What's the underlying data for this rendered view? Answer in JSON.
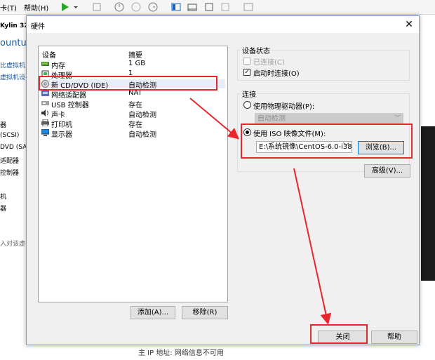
{
  "host": {
    "menu": [
      "卡(T)",
      "帮助(H)"
    ],
    "left_texts": [
      "Kylin 32",
      "ountu",
      "比虚拟机",
      "虚拟机设",
      "器",
      "(SCSI)",
      "DVD (SAT",
      "适配器",
      "控制器",
      "机",
      "器",
      "入对该虚"
    ],
    "bottom_text": "主 IP 地址: 网络信息不可用"
  },
  "dialog": {
    "title": "硬件",
    "close_glyph": "✕",
    "device_table": {
      "headers": [
        "设备",
        "摘要"
      ],
      "rows": [
        {
          "name": "内存",
          "summary": "1 GB",
          "icon": "memory-icon"
        },
        {
          "name": "处理器",
          "summary": "1",
          "icon": "processor-icon"
        },
        {
          "name": "新 CD/DVD (IDE)",
          "summary": "自动检测",
          "icon": "cd-dvd-icon"
        },
        {
          "name": "网络适配器",
          "summary": "NAT",
          "icon": "network-adapter-icon"
        },
        {
          "name": "USB 控制器",
          "summary": "存在",
          "icon": "usb-icon"
        },
        {
          "name": "声卡",
          "summary": "自动检测",
          "icon": "sound-card-icon"
        },
        {
          "name": "打印机",
          "summary": "存在",
          "icon": "printer-icon"
        },
        {
          "name": "显示器",
          "summary": "自动检测",
          "icon": "display-icon"
        }
      ]
    },
    "add_button": "添加(A)...",
    "remove_button": "移除(R)",
    "device_status": {
      "label": "设备状态",
      "connected": {
        "label": "已连接(C)",
        "checked": false,
        "disabled": true
      },
      "connect_at_power_on": {
        "label": "启动时连接(O)",
        "checked": true
      }
    },
    "connection": {
      "label": "连接",
      "use_physical": {
        "label": "使用物理驱动器(P):",
        "selected": false
      },
      "physical_value": "自动检测",
      "use_iso": {
        "label": "使用 ISO 映像文件(M):",
        "selected": true
      },
      "iso_path": "E:\\系统镜像\\CentOS-6.0-i38",
      "browse_button": "浏览(B)..."
    },
    "advanced_button": "高级(V)...",
    "close_button": "关闭",
    "help_button": "帮助"
  }
}
